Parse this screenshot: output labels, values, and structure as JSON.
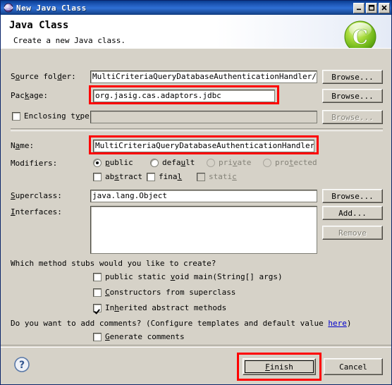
{
  "window": {
    "title": "New Java Class",
    "icon": "java-wizard-globe-icon",
    "controls": {
      "minimize": "–",
      "maximize": "□",
      "close": "✕"
    }
  },
  "banner": {
    "title": "Java Class",
    "subtitle": "Create a new Java class.",
    "icon": "new-java-class-icon",
    "icon_letter": "C",
    "icon_color": "#7fc41c"
  },
  "form": {
    "source_folder": {
      "label": "Source folder:",
      "mnemonic": "d",
      "value": "MultiCriteriaQueryDatabaseAuthenticationHandler/src",
      "button": "Browse...",
      "button_mnemonic": "o"
    },
    "package": {
      "label": "Package:",
      "mnemonic": "k",
      "value": "org.jasig.cas.adaptors.jdbc",
      "button": "Browse...",
      "button_mnemonic": "w",
      "highlighted": true
    },
    "enclosing_type": {
      "label": "Enclosing type:",
      "mnemonic": "y",
      "checked": false,
      "value": "",
      "enabled": false,
      "button": "Browse...",
      "button_mnemonic": "w"
    },
    "name": {
      "label": "Name:",
      "mnemonic": "a",
      "value": "MultiCriteriaQueryDatabaseAuthenticationHandler",
      "highlighted": true
    },
    "modifiers": {
      "label": "Modifiers:",
      "radios": [
        {
          "label": "public",
          "mnemonic": "p",
          "selected": true,
          "enabled": true
        },
        {
          "label": "default",
          "mnemonic": "u",
          "selected": false,
          "enabled": true
        },
        {
          "label": "private",
          "mnemonic": "v",
          "selected": false,
          "enabled": false
        },
        {
          "label": "protected",
          "mnemonic": "t",
          "selected": false,
          "enabled": false
        }
      ],
      "checkboxes": [
        {
          "label": "abstract",
          "mnemonic": "s",
          "checked": false,
          "enabled": true
        },
        {
          "label": "final",
          "mnemonic": "l",
          "checked": false,
          "enabled": true
        },
        {
          "label": "static",
          "mnemonic": "c",
          "checked": false,
          "enabled": false
        }
      ]
    },
    "superclass": {
      "label": "Superclass:",
      "mnemonic": "S",
      "value": "java.lang.Object",
      "button": "Browse...",
      "button_mnemonic": "e"
    },
    "interfaces": {
      "label": "Interfaces:",
      "mnemonic": "I",
      "items": [],
      "add_button": "Add...",
      "add_mnemonic": "A",
      "remove_button": "Remove",
      "remove_enabled": false,
      "remove_mnemonic": "R"
    },
    "stubs": {
      "question": "Which method stubs would you like to create?",
      "options": [
        {
          "label": "public static void main(String[] args)",
          "checked": false
        },
        {
          "label": "Constructors from superclass",
          "checked": false
        },
        {
          "label": "Inherited abstract methods",
          "checked": true
        }
      ]
    },
    "comments": {
      "question_prefix": "Do you want to add comments? (Configure templates and default value ",
      "link": "here",
      "question_suffix": ")",
      "option": {
        "label": "Generate comments",
        "checked": false
      }
    }
  },
  "footer": {
    "help_icon": "help-question-icon",
    "finish": "Finish",
    "finish_mnemonic": "F",
    "finish_highlighted": true,
    "cancel": "Cancel"
  },
  "annotation_color": "#ff0000"
}
